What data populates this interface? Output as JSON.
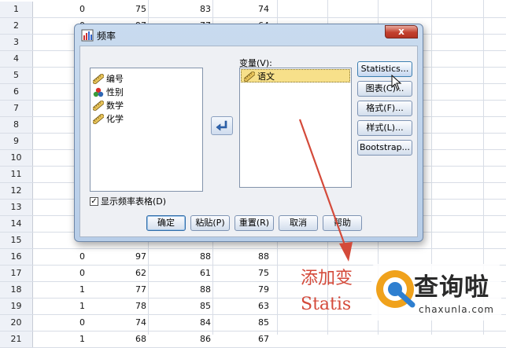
{
  "sheet": {
    "rows": [
      {
        "n": "1",
        "c": [
          "0",
          "75",
          "83",
          "74"
        ]
      },
      {
        "n": "2",
        "c": [
          "0",
          "97",
          "77",
          "64"
        ]
      },
      {
        "n": "3",
        "c": [
          "",
          "",
          "",
          ""
        ]
      },
      {
        "n": "4",
        "c": [
          "",
          "",
          "",
          ""
        ]
      },
      {
        "n": "5",
        "c": [
          "",
          "",
          "",
          ""
        ]
      },
      {
        "n": "6",
        "c": [
          "",
          "",
          "",
          ""
        ]
      },
      {
        "n": "7",
        "c": [
          "",
          "",
          "",
          ""
        ]
      },
      {
        "n": "8",
        "c": [
          "",
          "",
          "",
          ""
        ]
      },
      {
        "n": "9",
        "c": [
          "",
          "",
          "",
          ""
        ]
      },
      {
        "n": "10",
        "c": [
          "",
          "",
          "",
          ""
        ]
      },
      {
        "n": "11",
        "c": [
          "",
          "",
          "",
          ""
        ]
      },
      {
        "n": "12",
        "c": [
          "",
          "",
          "",
          ""
        ]
      },
      {
        "n": "13",
        "c": [
          "",
          "",
          "",
          ""
        ]
      },
      {
        "n": "14",
        "c": [
          "",
          "",
          "",
          ""
        ]
      },
      {
        "n": "15",
        "c": [
          "",
          "",
          "",
          ""
        ]
      },
      {
        "n": "16",
        "c": [
          "0",
          "97",
          "88",
          "88"
        ]
      },
      {
        "n": "17",
        "c": [
          "0",
          "62",
          "61",
          "75"
        ]
      },
      {
        "n": "18",
        "c": [
          "1",
          "77",
          "88",
          "79"
        ]
      },
      {
        "n": "19",
        "c": [
          "1",
          "78",
          "85",
          "63"
        ]
      },
      {
        "n": "20",
        "c": [
          "0",
          "74",
          "84",
          "85"
        ]
      },
      {
        "n": "21",
        "c": [
          "1",
          "68",
          "86",
          "67"
        ]
      }
    ]
  },
  "dialog": {
    "title": "频率",
    "close_label": "x",
    "variables_label": "变量(V):",
    "source_items": [
      {
        "label": "编号",
        "icon": "ruler-icon"
      },
      {
        "label": "性别",
        "icon": "nominal-icon"
      },
      {
        "label": "数学",
        "icon": "ruler-icon"
      },
      {
        "label": "化学",
        "icon": "ruler-icon"
      }
    ],
    "target_items": [
      {
        "label": "语文",
        "icon": "ruler-icon"
      }
    ],
    "side_buttons": [
      "Statistics...",
      "图表(C)...",
      "格式(F)...",
      "样式(L)...",
      "Bootstrap..."
    ],
    "checkbox_label": "显示频率表格(D)",
    "checkbox_checked": true,
    "bottom_buttons": [
      "确定",
      "粘贴(P)",
      "重置(R)",
      "取消",
      "帮助"
    ]
  },
  "annotation": {
    "line1": "添加变",
    "line2": "Statis"
  },
  "watermark": {
    "name": "查询啦",
    "site": "chaxunla.com"
  },
  "colors": {
    "annotation": "#d44a3a",
    "selection": "#f7e08a",
    "dialog_frame": "#b7cde8"
  }
}
